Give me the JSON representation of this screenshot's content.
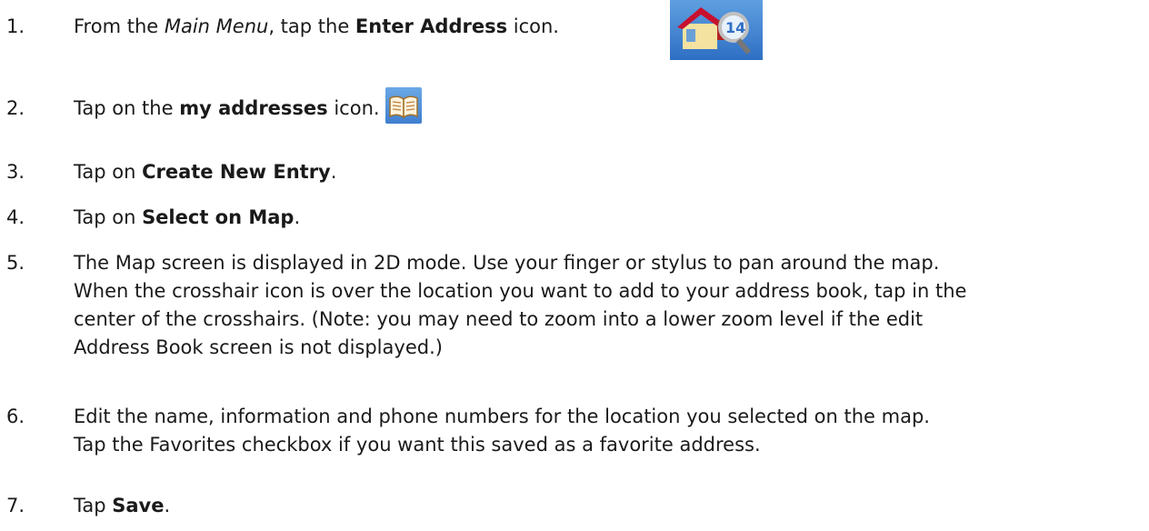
{
  "steps": [
    {
      "num": "1.",
      "parts": [
        "From the ",
        "Main Menu",
        ", tap the ",
        "Enter Address",
        " icon."
      ],
      "icon": "house-magnifier-icon"
    },
    {
      "num": "2.",
      "parts": [
        "Tap on the ",
        "my addresses",
        " icon."
      ],
      "icon": "open-book-icon"
    },
    {
      "num": "3.",
      "parts": [
        "Tap on ",
        "Create New Entry",
        "."
      ]
    },
    {
      "num": "4.",
      "parts": [
        "Tap on ",
        "Select on Map",
        "."
      ]
    },
    {
      "num": "5.",
      "lines": [
        "The Map screen is displayed in 2D mode.  Use your finger or stylus to pan around the map.",
        "When the crosshair icon is over the location you want to add to your address book, tap in the",
        "center of the crosshairs. (Note: you may need to zoom into a lower zoom level if the edit",
        "Address Book screen is not displayed.)"
      ]
    },
    {
      "num": "6.",
      "lines": [
        "Edit the name, information and phone numbers for the location you selected on the map.",
        "Tap the Favorites checkbox if you want this saved as a favorite address."
      ]
    },
    {
      "num": "7.",
      "parts": [
        "Tap ",
        "Save",
        "."
      ]
    }
  ],
  "icon_colors": {
    "background": "#2f6fc4",
    "roof": "#c8102e",
    "badge": "#ffffff"
  }
}
